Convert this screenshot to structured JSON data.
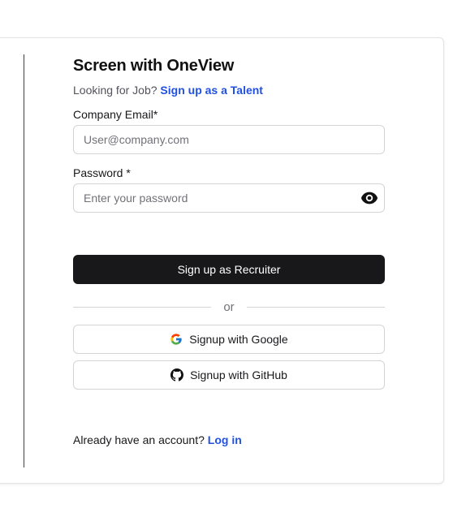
{
  "form": {
    "title": "Screen with OneView",
    "subtitle_prefix": "Looking for Job?",
    "subtitle_link": "Sign up as a Talent",
    "email_label": "Company Email*",
    "email_placeholder": "User@company.com",
    "password_label": "Password *",
    "password_placeholder": "Enter your password",
    "submit_label": "Sign up as Recruiter",
    "or_text": "or",
    "google_label": "Signup with Google",
    "github_label": "Signup with GitHub",
    "footer_prefix": "Already have an account?",
    "footer_link": "Log in"
  },
  "icons": {
    "password_toggle": "eye-icon",
    "google": "google-icon",
    "github": "github-icon"
  },
  "colors": {
    "link": "#2151e0",
    "primary_button": "#18181b",
    "border": "#d4d4d8"
  }
}
